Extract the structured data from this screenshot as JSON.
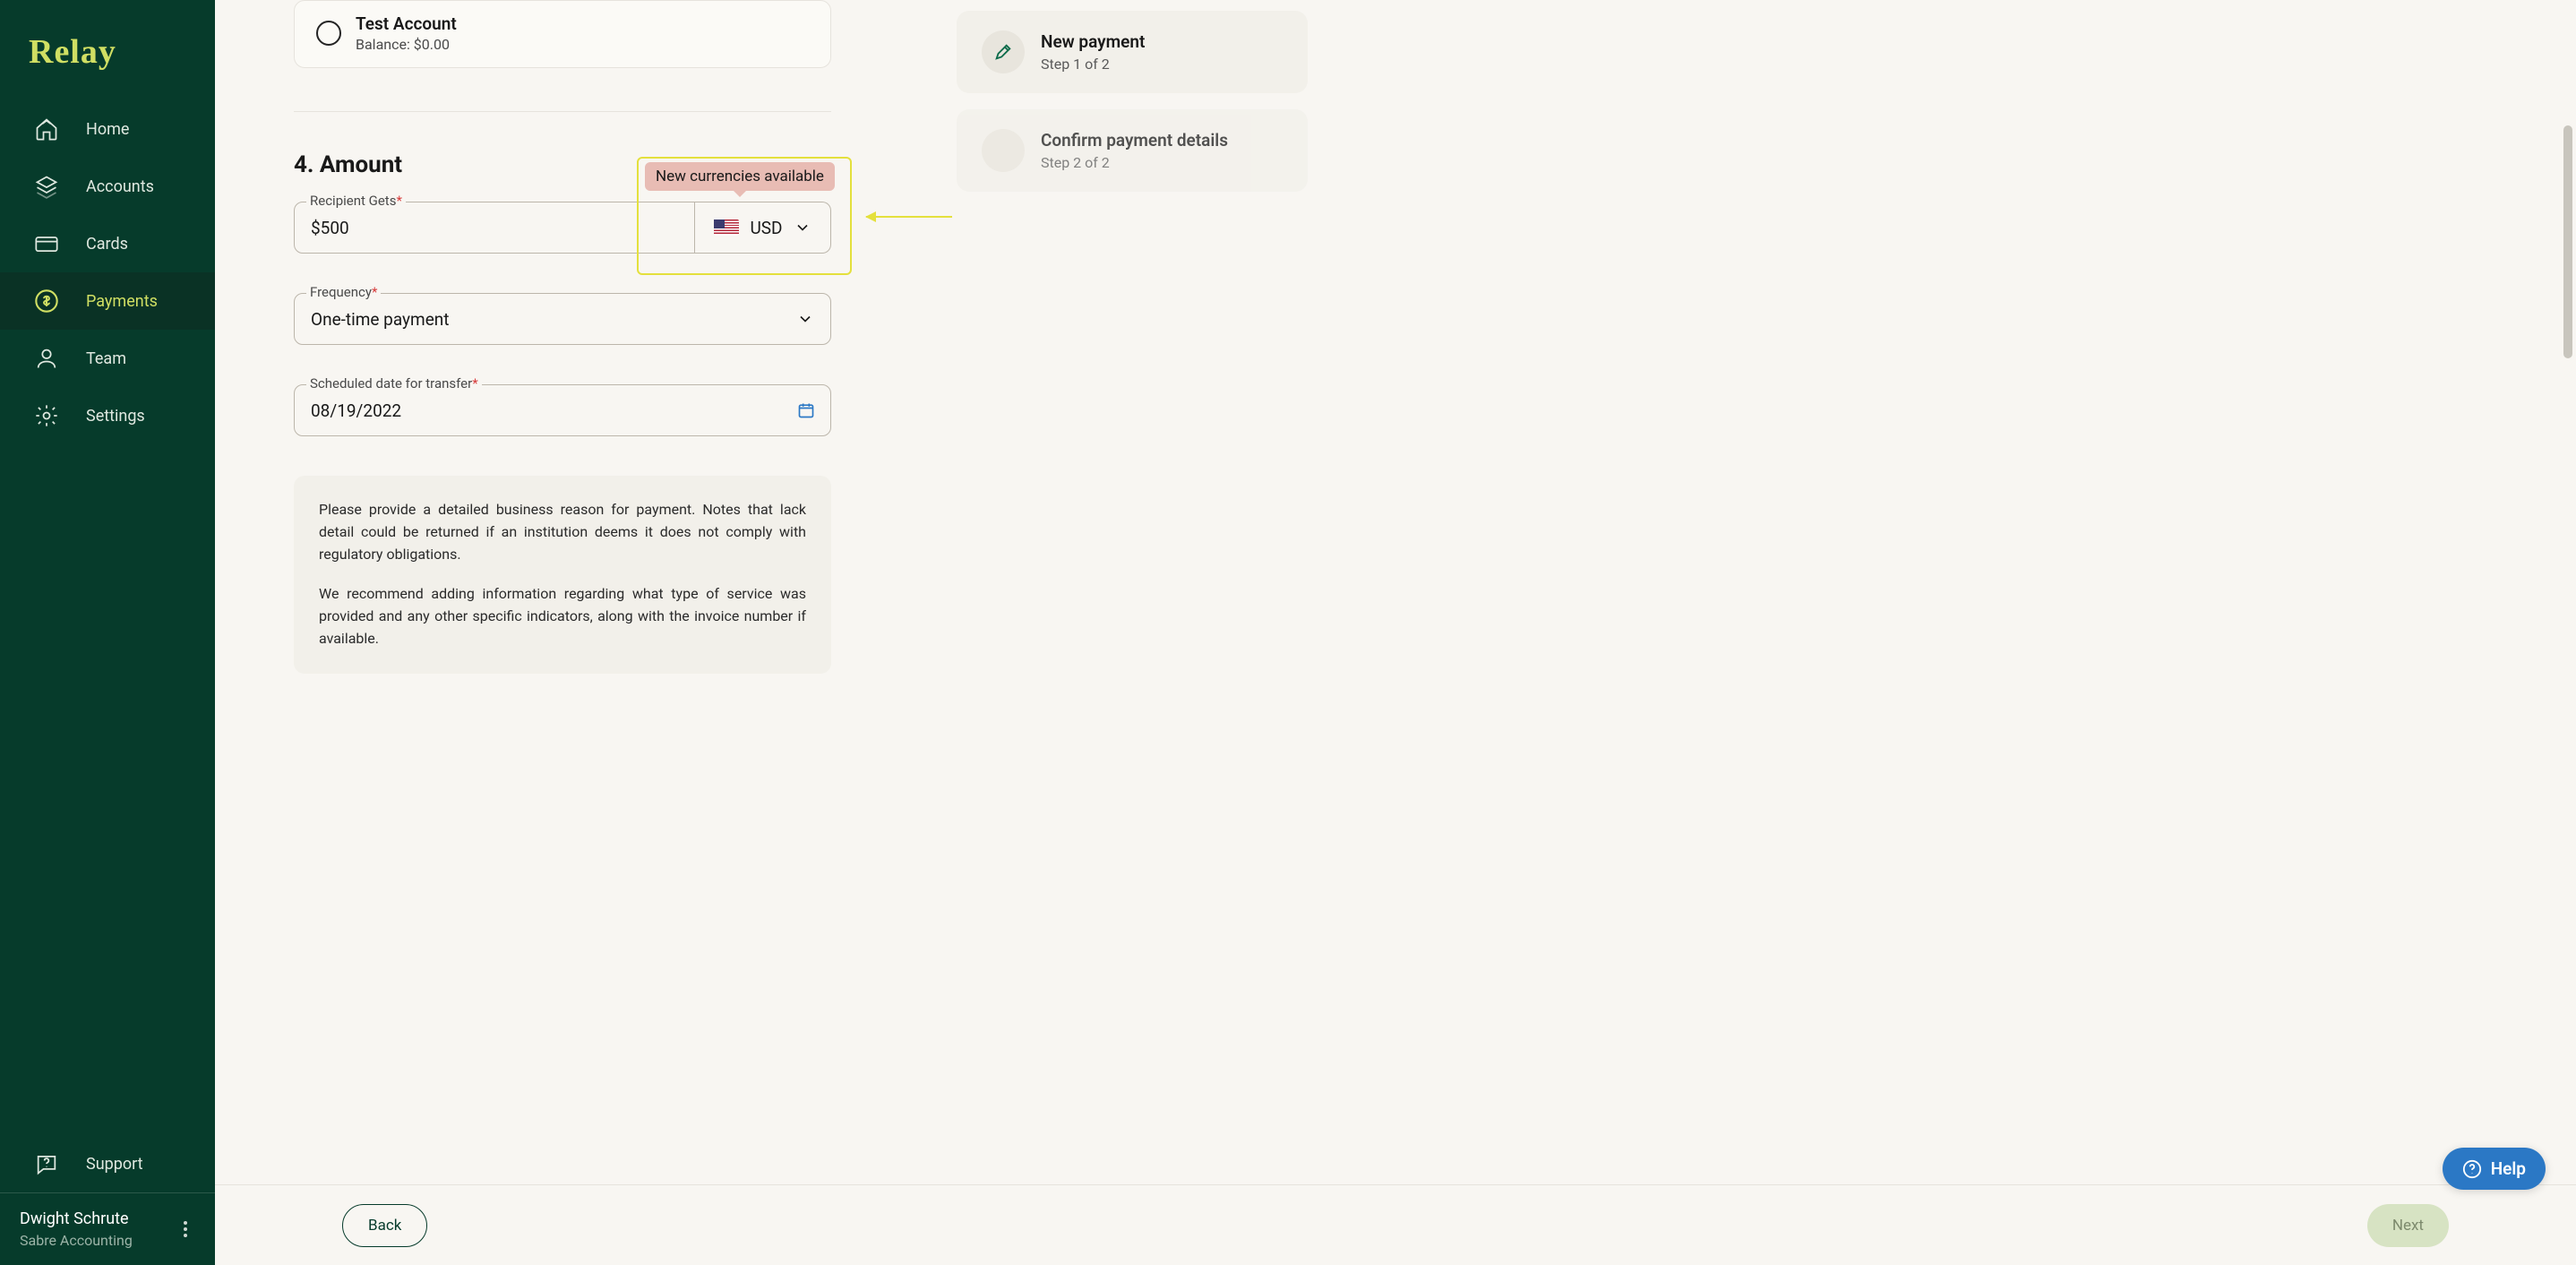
{
  "brand": "Relay",
  "nav": {
    "home": "Home",
    "accounts": "Accounts",
    "cards": "Cards",
    "payments": "Payments",
    "team": "Team",
    "settings": "Settings",
    "support": "Support"
  },
  "user": {
    "name": "Dwight Schrute",
    "org": "Sabre Accounting"
  },
  "account_card": {
    "name": "Test Account",
    "balance_label": "Balance: $0.00"
  },
  "section": {
    "heading": "4. Amount"
  },
  "callout": "New currencies available",
  "fields": {
    "recipient_label": "Recipient Gets",
    "recipient_value": "$500",
    "currency_code": "USD",
    "frequency_label": "Frequency",
    "frequency_value": "One-time payment",
    "date_label": "Scheduled date for transfer",
    "date_value": "08/19/2022"
  },
  "info": {
    "p1": "Please provide a detailed business reason for payment. Notes that lack detail could be returned if an institution deems it does not comply with regulatory obligations.",
    "p2": "We recommend adding information regarding what type of service was provided and any other specific indicators, along with the invoice number if available."
  },
  "steps": {
    "s1_title": "New payment",
    "s1_sub": "Step 1 of 2",
    "s2_title": "Confirm payment details",
    "s2_sub": "Step 2 of 2"
  },
  "footer": {
    "back": "Back",
    "next": "Next"
  },
  "help": "Help"
}
